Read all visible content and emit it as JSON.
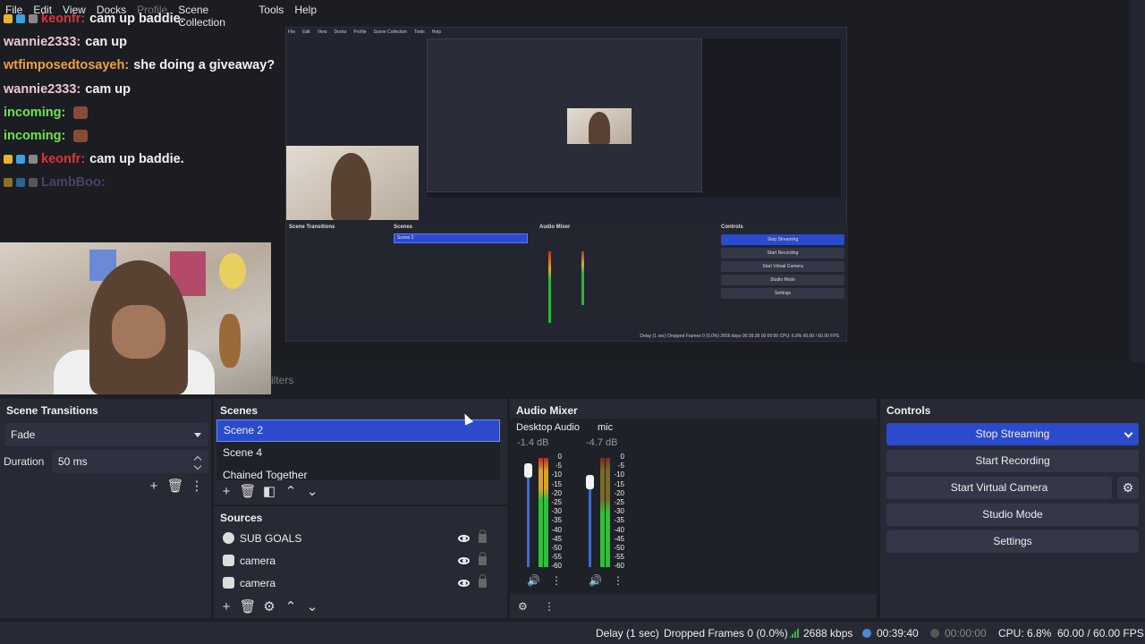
{
  "menu": [
    "File",
    "Edit",
    "View",
    "Docks",
    "Profile",
    "Scene Collection",
    "Tools",
    "Help"
  ],
  "chat": [
    {
      "user": "keonfr:",
      "msg": "cam up baddie.",
      "color": "#e0303a",
      "badges": true
    },
    {
      "user": "wannie2333:",
      "msg": "can up",
      "color": "#e8c8d8",
      "badges": false
    },
    {
      "user": "wtfimposedtosayeh:",
      "msg": "she doing a giveaway?",
      "color": "#f0a040",
      "badges": false
    },
    {
      "user": "wannie2333:",
      "msg": "cam up",
      "color": "#e8c8d8",
      "badges": false
    },
    {
      "user": "incoming:",
      "msg": "",
      "color": "#6ee64a",
      "badges": false,
      "emote": true
    },
    {
      "user": "incoming:",
      "msg": "",
      "color": "#6ee64a",
      "badges": false,
      "emote": true
    },
    {
      "user": "keonfr:",
      "msg": "cam up baddie.",
      "color": "#e0303a",
      "badges": true
    },
    {
      "user": "LambBoo:",
      "msg": "",
      "color": "#7a5aa8",
      "badges": true,
      "faded": true
    }
  ],
  "filters_ghost": "ilters",
  "scene_transitions": {
    "title": "Scene Transitions",
    "transition": "Fade",
    "duration_label": "Duration",
    "duration_value": "50 ms"
  },
  "scenes": {
    "title": "Scenes",
    "items": [
      "Scene 2",
      "Scene 4",
      "Chained Together"
    ],
    "selected": "Scene 2"
  },
  "sources": {
    "title": "Sources",
    "items": [
      "SUB GOALS",
      "camera",
      "camera"
    ]
  },
  "audio_mixer": {
    "title": "Audio Mixer",
    "channels": [
      {
        "name": "Desktop Audio",
        "db": "-1.4 dB"
      },
      {
        "name": "mic",
        "db": "-4.7 dB"
      }
    ],
    "scale": [
      "0",
      "-5",
      "-10",
      "-15",
      "-20",
      "-25",
      "-30",
      "-35",
      "-40",
      "-45",
      "-50",
      "-55",
      "-60"
    ]
  },
  "controls": {
    "title": "Controls",
    "stop_streaming": "Stop Streaming",
    "start_recording": "Start Recording",
    "start_virtual_camera": "Start Virtual Camera",
    "studio_mode": "Studio Mode",
    "settings": "Settings"
  },
  "status": {
    "delay": "Delay (1 sec)",
    "dropped": "Dropped Frames 0 (0.0%)",
    "bitrate": "2688 kbps",
    "stream_time": "00:39:40",
    "record_time": "00:00:00",
    "cpu": "CPU: 6.8%",
    "fps": "60.00 / 60.00 FPS"
  },
  "nested": {
    "menu": [
      "File",
      "Edit",
      "View",
      "Docks",
      "Profile",
      "Scene Collection",
      "Tools",
      "Help"
    ],
    "status": "Delay (1 sec)   Dropped Frames 0 (0.0%)   2656 kbps   00:39:38   00:00:00   CPU: 6.8%   60.00 / 60.00 FPS"
  },
  "colors": {
    "accent": "#2b4bcc",
    "panel": "#272a34",
    "background": "#1d1f26"
  }
}
